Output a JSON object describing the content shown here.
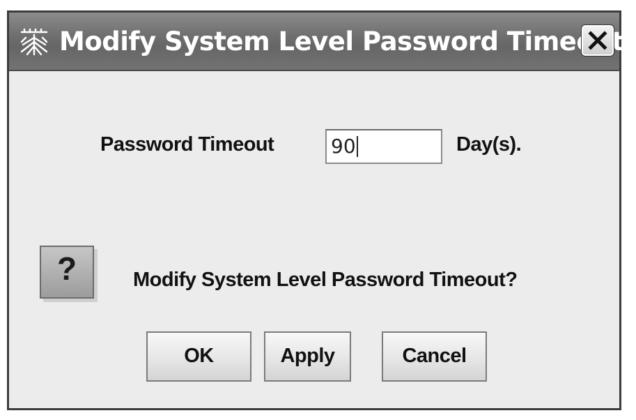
{
  "dialog": {
    "title": "Modify System Level Password Timeout",
    "app_icon": "java-cup-icon",
    "close_icon": "close-icon"
  },
  "form": {
    "label": "Password Timeout",
    "value": "90",
    "unit": "Day(s)."
  },
  "message": {
    "icon": "question-icon",
    "icon_glyph": "?",
    "text": "Modify System Level Password Timeout?"
  },
  "buttons": {
    "ok": "OK",
    "apply": "Apply",
    "cancel": "Cancel"
  }
}
